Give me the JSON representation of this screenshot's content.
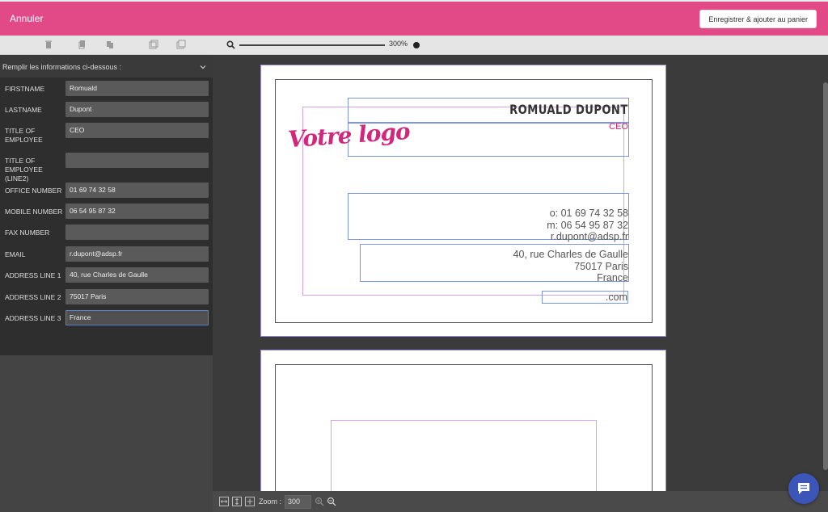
{
  "header": {
    "cancel_label": "Annuler",
    "save_label": "Enregistrer & ajouter au panier"
  },
  "toolbar": {
    "zoom_percent": "300%"
  },
  "panel": {
    "title": "Remplir les informations ci-dessous :",
    "fields": [
      {
        "label": "FIRSTNAME",
        "value": "Romuald"
      },
      {
        "label": "LASTNAME",
        "value": "Dupont"
      },
      {
        "label": "TITLE OF EMPLOYEE",
        "value": "CEO"
      },
      {
        "label": "TITLE OF EMPLOYEE (line2)",
        "value": ""
      },
      {
        "label": "OFFICE NUMBER",
        "value": "01 69 74 32 58"
      },
      {
        "label": "MOBILE NUMBER",
        "value": "06 54 95 87 32"
      },
      {
        "label": "FAX NUMBER",
        "value": ""
      },
      {
        "label": "EMAIL",
        "value": "r.dupont@adsp.fr"
      },
      {
        "label": "ADDRESS LINE 1",
        "value": "40, rue Charles de Gaulle"
      },
      {
        "label": "ADDRESS LINE 2",
        "value": "75017 Paris"
      },
      {
        "label": "ADDRESS LINE 3",
        "value": "France"
      }
    ]
  },
  "card": {
    "name": "ROMUALD DUPONT",
    "title": "CEO",
    "logo": "Votre logo",
    "office": "o: 01 69 74 32 58",
    "mobile": "m: 06 54 95 87 32",
    "email": "r.dupont@adsp.fr",
    "address1": "40, rue Charles de Gaulle",
    "address2": "75017 Paris",
    "address3": "France",
    "website": ".com"
  },
  "bottombar": {
    "zoom_label": "Zoom :",
    "zoom_value": "300"
  },
  "colors": {
    "accent": "#e14a86",
    "logo": "#d2287c",
    "chat": "#3b55b9"
  }
}
